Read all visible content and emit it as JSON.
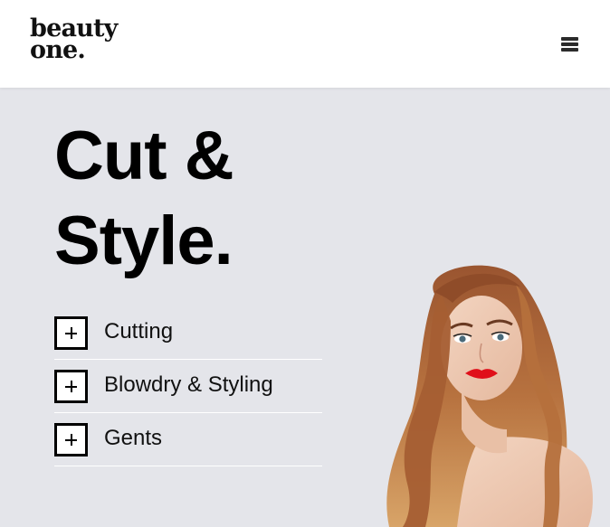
{
  "header": {
    "logo_line1": "beauty",
    "logo_line2": "one."
  },
  "hero": {
    "title_line1": "Cut &",
    "title_line2": "Style."
  },
  "services": [
    {
      "label": "Cutting",
      "icon": "plus-icon"
    },
    {
      "label": "Blowdry & Styling",
      "icon": "plus-icon"
    },
    {
      "label": "Gents",
      "icon": "plus-icon"
    }
  ],
  "colors": {
    "page_background": "#e4e5ea",
    "header_background": "#ffffff",
    "text": "#000000"
  }
}
